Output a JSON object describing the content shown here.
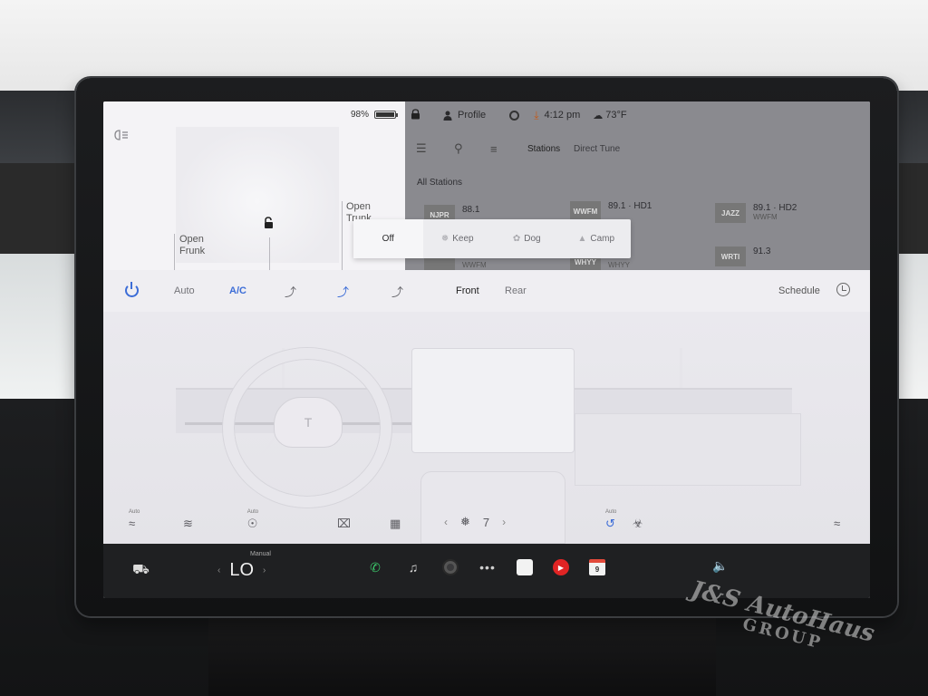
{
  "car_panel": {
    "battery_percent": "98%",
    "battery_level": 0.98,
    "open_frunk": [
      "Open",
      "Frunk"
    ],
    "open_trunk": [
      "Open",
      "Trunk"
    ]
  },
  "status_bar": {
    "profile_label": "Profile",
    "time": "4:12 pm",
    "temperature": "73°F"
  },
  "media": {
    "tabs": [
      "Stations",
      "Direct Tune"
    ],
    "all_stations_label": "All Stations",
    "stations": [
      {
        "logo": "NJPR",
        "freq": "88.1",
        "sub": ""
      },
      {
        "logo": "WWFM",
        "freq": "89.1 · HD1",
        "sub": ""
      },
      {
        "logo": "JAZZ",
        "freq": "89.1 · HD2",
        "sub": "WWFM"
      },
      {
        "logo": "",
        "freq": "",
        "sub": "WWFM"
      },
      {
        "logo": "WHYY",
        "freq": "",
        "sub": "WHYY"
      },
      {
        "logo": "WRTI",
        "freq": "91.3",
        "sub": ""
      }
    ]
  },
  "mode_popup": {
    "modes": [
      "Off",
      "Keep",
      "Dog",
      "Camp"
    ],
    "selected": "Off"
  },
  "climate": {
    "auto_label": "Auto",
    "ac_label": "A/C",
    "front_label": "Front",
    "rear_label": "Rear",
    "schedule_label": "Schedule",
    "seat_auto_label": "Auto",
    "wheel_auto_label": "Auto",
    "recirc_auto_label": "Auto",
    "fan_speed": "7",
    "steering_logo": "T"
  },
  "bottom_bar": {
    "temp_mode": "Manual",
    "temp_value": "LO",
    "calendar_day": "9"
  },
  "watermark": {
    "line1": "J&S AutoHaus",
    "line2": "GROUP"
  }
}
